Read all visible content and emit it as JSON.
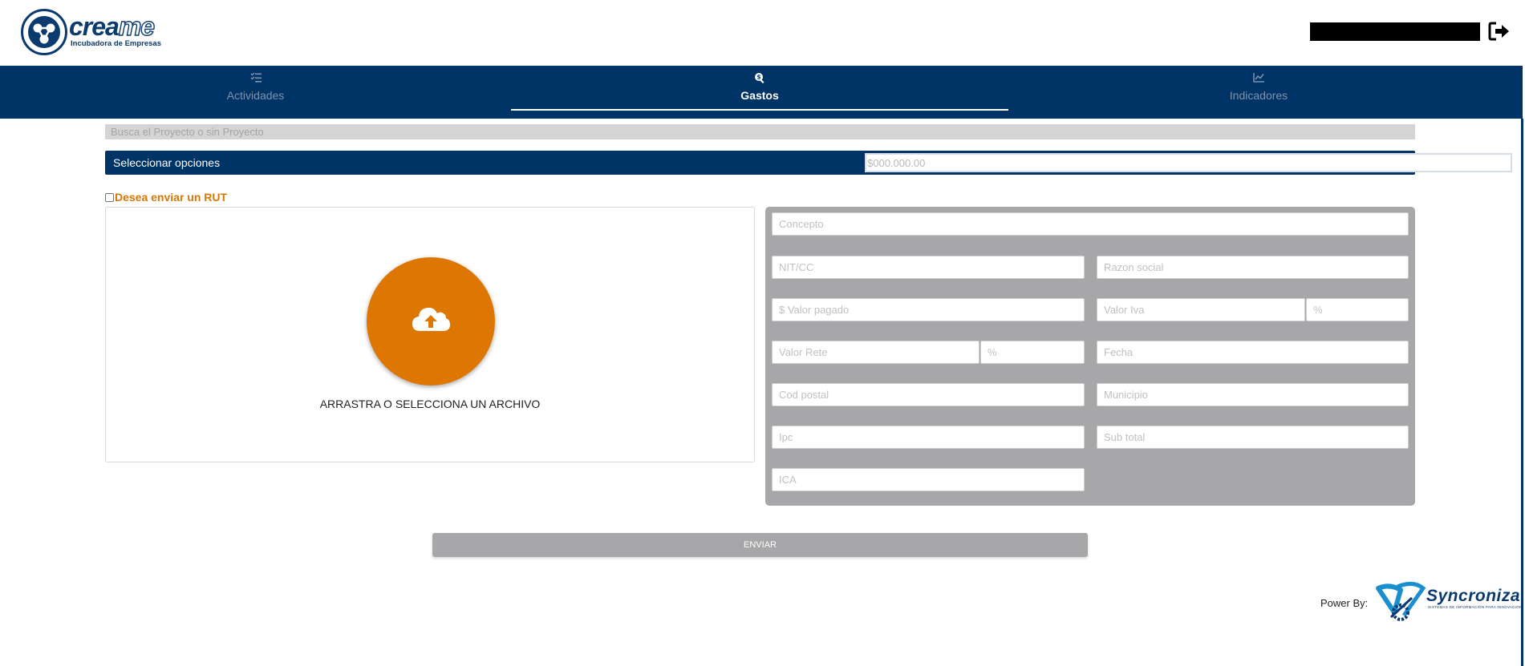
{
  "header": {
    "logo_word_a": "crea",
    "logo_word_b": "me",
    "logo_subtitle": "Incubadora de Empresas"
  },
  "nav": {
    "tabs": [
      {
        "label": "Actividades",
        "icon": "list-check-icon"
      },
      {
        "label": "Gastos",
        "icon": "search-dollar-icon",
        "active": true
      },
      {
        "label": "Indicadores",
        "icon": "chart-line-icon"
      }
    ]
  },
  "search": {
    "placeholder": "Busca el Proyecto o sin Proyecto"
  },
  "select": {
    "label": "Seleccionar opciones",
    "amount_placeholder": "$000.000.00"
  },
  "rut": {
    "label": "Desea enviar un RUT"
  },
  "upload": {
    "text": "ARRASTRA O SELECCIONA UN ARCHIVO",
    "icon": "cloud-upload-icon"
  },
  "form": {
    "concepto": "Concepto",
    "nit": "NIT/CC",
    "razon_social": "Razon social",
    "valor_pagado": "$ Valor pagado",
    "valor_iva": "Valor Iva",
    "iva_pct": "%",
    "valor_rete": "Valor Rete",
    "rete_pct": "%",
    "fecha": "Fecha",
    "cod_postal": "Cod postal",
    "municipio": "Municipio",
    "ipc": "Ipc",
    "sub_total": "Sub total",
    "ica": "ICA"
  },
  "actions": {
    "send_label": "ENVIAR"
  },
  "footer": {
    "power_by": "Power By:",
    "sync_word": "Syncroniza",
    "sync_sub": "SISTEMAS DE INFORMACIÓN PARA INNOVACIÓN"
  },
  "colors": {
    "navy": "#003366",
    "orange": "#dd7702",
    "panel_gray": "#a7a7a9"
  }
}
